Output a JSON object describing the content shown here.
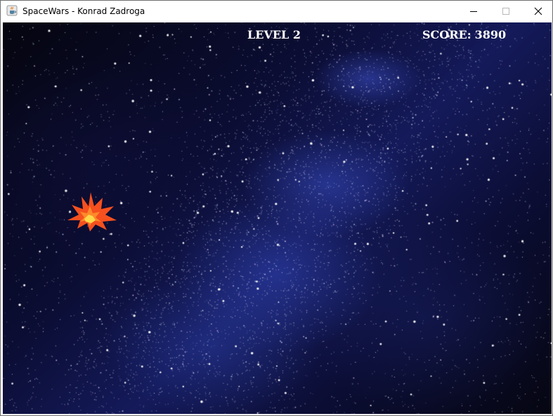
{
  "window": {
    "title": "SpaceWars - Konrad Zadroga"
  },
  "hud": {
    "level_label": "LEVEL",
    "level_value": "2",
    "score_label": "SCORE:",
    "score_value": "3890"
  },
  "colors": {
    "hud_text": "#ffffff",
    "space_dark": "#05050f",
    "nebula_blue": "#3c50c8",
    "explosion_outer": "#f5501e",
    "explosion_inner": "#ffd84a"
  },
  "icons": {
    "app_icon": "java-coffee-cup-icon",
    "explosion": "explosion-burst"
  }
}
